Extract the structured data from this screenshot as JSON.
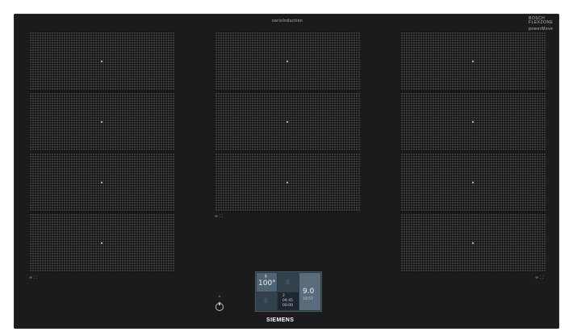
{
  "header": {
    "top_label": "varioInduction",
    "top_right_label": "BOSCH FLEXZONE",
    "top_right_sub": "powerMove"
  },
  "zones": {
    "left_mark": "∞ ⸬",
    "center_mark": "∞ ⸬",
    "right_mark": "∞ ⸬"
  },
  "display": {
    "tile1_value": "100°",
    "tile1_icon": "thermometer-icon",
    "tile2_value": "8",
    "tile3_value": "6",
    "tile4_lines": [
      "2",
      "04:45",
      "00:00"
    ],
    "tile5_value": "9.0",
    "tile5_time": "19:57"
  },
  "brand": "SIEMENS"
}
